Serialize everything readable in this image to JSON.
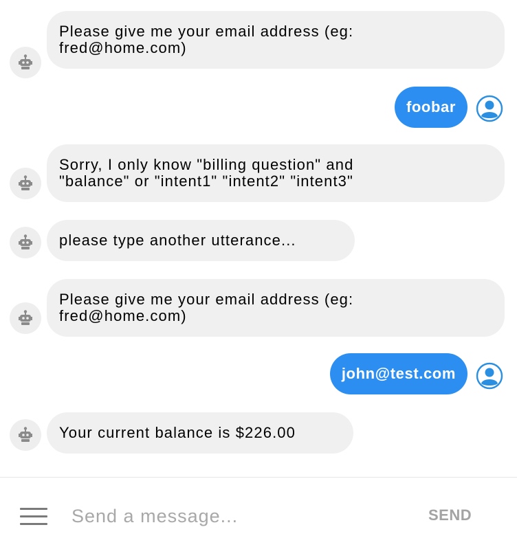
{
  "messages": [
    {
      "sender": "bot",
      "text": "Please give me your email address (eg:\nfred@home.com)"
    },
    {
      "sender": "user",
      "text": "foobar"
    },
    {
      "sender": "bot",
      "text": "Sorry, I only know \"billing question\" and\n\"balance\" or \"intent1\" \"intent2\" \"intent3\""
    },
    {
      "sender": "bot",
      "text": "please type another utterance..."
    },
    {
      "sender": "bot",
      "text": "Please give me your email address (eg:\nfred@home.com)"
    },
    {
      "sender": "user",
      "text": "john@test.com"
    },
    {
      "sender": "bot",
      "text": "Your current balance is $226.00"
    }
  ],
  "composer": {
    "placeholder": "Send a message...",
    "send_label": "SEND"
  },
  "icons": {
    "bot_avatar": "robot-icon",
    "user_avatar": "user-icon",
    "menu": "hamburger-menu-icon"
  },
  "colors": {
    "user_bubble": "#2b8ef0",
    "bot_bubble": "#f0f0f0",
    "avatar_bg": "#eeeeee",
    "user_avatar": "#2a8fe0"
  }
}
